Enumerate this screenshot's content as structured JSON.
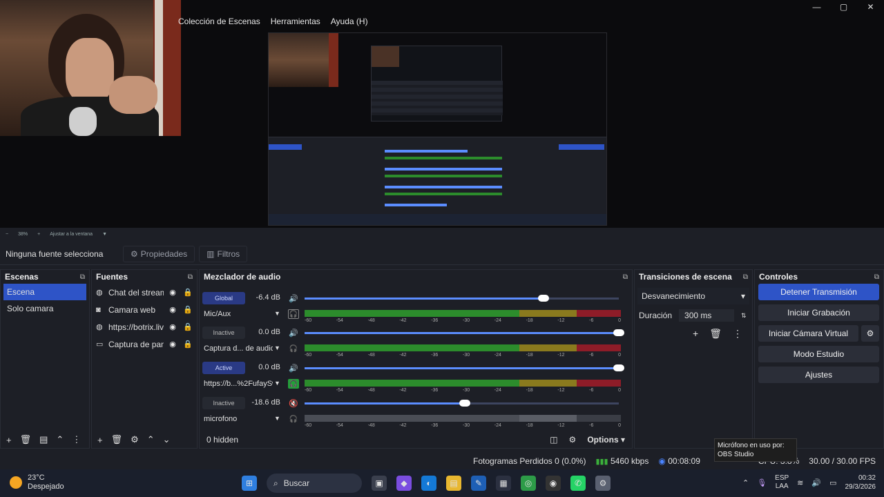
{
  "menu": [
    "Colección de Escenas",
    "Herramientas",
    "Ayuda (H)"
  ],
  "window_controls": [
    "—",
    "▢",
    "✕"
  ],
  "zoom": {
    "value": "38%",
    "minus": "−",
    "plus": "+",
    "fit": "Ajustar a la ventana"
  },
  "source_toolbar": {
    "selection": "Ninguna fuente selecciona",
    "properties": "Propiedades",
    "filters": "Filtros"
  },
  "scenes": {
    "title": "Escenas",
    "items": [
      "Escena",
      "Solo camara"
    ],
    "selected": 0
  },
  "sources": {
    "title": "Fuentes",
    "items": [
      {
        "name": "Chat del stream",
        "icon": "globe-icon"
      },
      {
        "name": "Camara web",
        "icon": "camera-icon"
      },
      {
        "name": "https://botrix.live",
        "icon": "globe-icon"
      },
      {
        "name": "Captura de pantalla",
        "icon": "monitor-icon"
      }
    ]
  },
  "mixer": {
    "title": "Mezclador de audio",
    "channels": [
      {
        "state": "Global",
        "active": true,
        "db": "-6.4 dB",
        "name": "Mic/Aux",
        "level": 0.76,
        "muted": false,
        "meter_on": true
      },
      {
        "state": "Inactive",
        "active": false,
        "db": "0.0 dB",
        "name": "Captura d... de audio",
        "level": 1.0,
        "muted": false,
        "meter_on": true
      },
      {
        "state": "Active",
        "active": true,
        "db": "0.0 dB",
        "name": "https://b...%2FufaySw",
        "level": 1.0,
        "muted": false,
        "meter_on": true
      },
      {
        "state": "Inactive",
        "active": false,
        "db": "-18.6 dB",
        "name": "microfono",
        "level": 0.51,
        "muted": true,
        "meter_on": false
      }
    ],
    "scale": [
      "-60",
      "-54",
      "-48",
      "-42",
      "-36",
      "-30",
      "-24",
      "-18",
      "-12",
      "-6",
      "0"
    ],
    "hidden": "0 hidden",
    "options": "Options"
  },
  "transitions": {
    "title": "Transiciones de escena",
    "type": "Desvanecimiento",
    "duration_label": "Duración",
    "duration": "300 ms"
  },
  "controls": {
    "title": "Controles",
    "stop_stream": "Detener Transmisión",
    "start_record": "Iniciar Grabación",
    "virtual_cam": "Iniciar Cámara Virtual",
    "studio": "Modo Estudio",
    "settings": "Ajustes"
  },
  "status": {
    "dropped": "Fotogramas Perdidos 0 (0.0%)",
    "kbps": "5460 kbps",
    "time": "00:08:09",
    "cpu": "CPU: 3.8%",
    "fps": "30.00 / 30.00 FPS"
  },
  "tooltip": "Micrófono en uso por: OBS Studio",
  "taskbar": {
    "temp": "23°C",
    "weather": "Despejado",
    "search": "Buscar",
    "lang1": "ESP",
    "lang2": "LAA",
    "time": "00:32",
    "date": "29/3/2026"
  },
  "colors": {
    "accent": "#2e54c7",
    "bg": "#1d1f26",
    "meter_green": "#2c8c2c",
    "meter_yellow": "#8a7a1e",
    "meter_red": "#8e1c28"
  }
}
